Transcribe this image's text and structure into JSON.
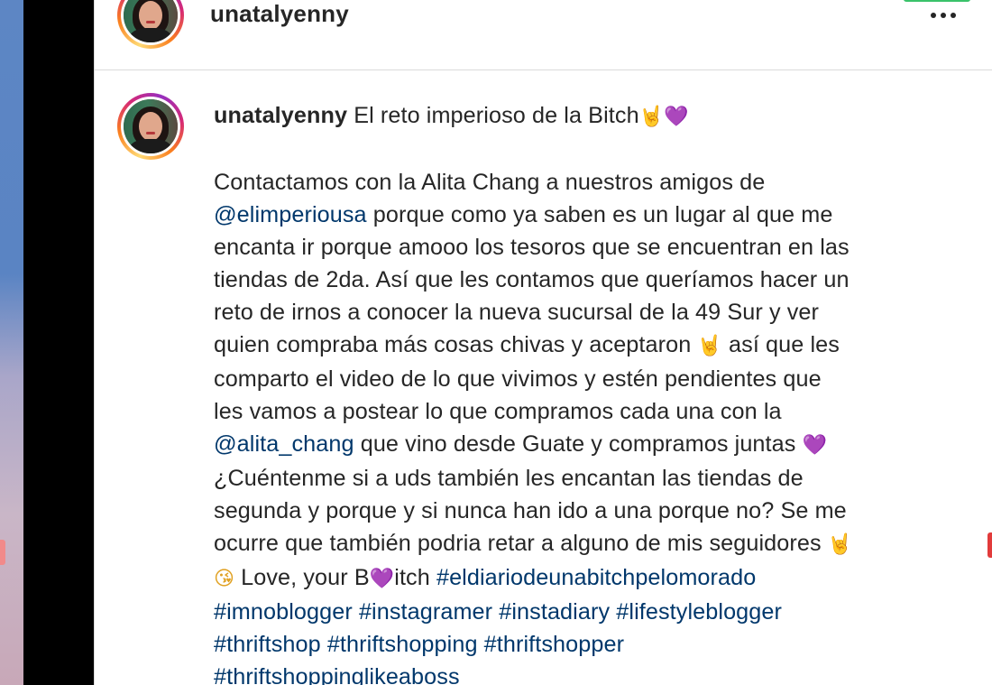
{
  "header": {
    "username": "unatalyenny",
    "more_label": "•••"
  },
  "caption": {
    "username": "unatalyenny",
    "title": "El reto imperioso de la Bitch",
    "title_emojis": "🤘💜",
    "lines": [
      {
        "parts": [
          {
            "t": "Contactamos con la Alita Chang a nuestros amigos de"
          }
        ]
      },
      {
        "parts": [
          {
            "t": "@elimperiousa",
            "k": "mention"
          },
          {
            "t": " porque como ya saben es un lugar al que me"
          }
        ]
      },
      {
        "parts": [
          {
            "t": "encanta ir porque amooo los tesoros que se encuentran en las"
          }
        ]
      },
      {
        "parts": [
          {
            "t": "tiendas de 2da. Así que les contamos que queríamos hacer un"
          }
        ]
      },
      {
        "parts": [
          {
            "t": "reto de irnos a conocer la nueva sucursal de la 49 Sur y ver"
          }
        ]
      },
      {
        "parts": [
          {
            "t": "quien compraba más cosas chivas y aceptaron "
          },
          {
            "t": "🤘",
            "k": "emoji"
          },
          {
            "t": " así que les"
          }
        ]
      },
      {
        "parts": [
          {
            "t": "comparto el video de lo que vivimos y estén pendientes que"
          }
        ]
      },
      {
        "parts": [
          {
            "t": "les vamos a postear lo que compramos cada una con la"
          }
        ]
      },
      {
        "parts": [
          {
            "t": "@alita_chang",
            "k": "mention"
          },
          {
            "t": " que vino desde Guate y compramos juntas "
          },
          {
            "t": "💜",
            "k": "heart"
          }
        ]
      },
      {
        "parts": [
          {
            "t": "¿Cuéntenme si a uds también les encantan las tiendas de"
          }
        ]
      },
      {
        "parts": [
          {
            "t": "segunda y porque y si nunca han ido a una porque no? Se me"
          }
        ]
      },
      {
        "parts": [
          {
            "t": "ocurre que también podria retar a alguno de mis seguidores "
          },
          {
            "t": "🤘",
            "k": "emoji"
          }
        ]
      },
      {
        "parts": [
          {
            "t": "😘",
            "k": "kiss"
          },
          {
            "t": " Love, your B"
          },
          {
            "t": "💜",
            "k": "heart"
          },
          {
            "t": "itch "
          },
          {
            "t": "#eldiariodeunabitchpelomorado",
            "k": "tag"
          }
        ]
      },
      {
        "parts": [
          {
            "t": "#imnoblogger",
            "k": "tag"
          },
          {
            "t": " "
          },
          {
            "t": "#instagramer",
            "k": "tag"
          },
          {
            "t": " "
          },
          {
            "t": "#instadiary",
            "k": "tag"
          },
          {
            "t": " "
          },
          {
            "t": "#lifestyleblogger",
            "k": "tag"
          }
        ]
      },
      {
        "parts": [
          {
            "t": "#thriftshop",
            "k": "tag"
          },
          {
            "t": " "
          },
          {
            "t": "#thriftshopping",
            "k": "tag"
          },
          {
            "t": " "
          },
          {
            "t": "#thriftshopper",
            "k": "tag"
          }
        ]
      },
      {
        "parts": [
          {
            "t": "#thriftshoppinglikeaboss",
            "k": "tag"
          }
        ]
      }
    ]
  },
  "colors": {
    "text": "#262626",
    "link": "#00376b",
    "border": "#dbdbdb"
  }
}
